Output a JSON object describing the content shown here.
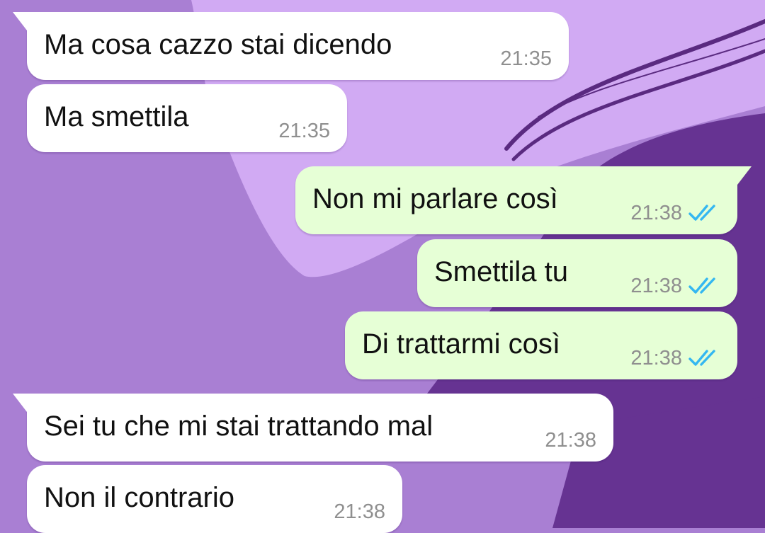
{
  "conversation": {
    "messages": [
      {
        "direction": "incoming",
        "text": "Ma cosa cazzo stai dicendo",
        "time": "21:35"
      },
      {
        "direction": "incoming",
        "text": "Ma smettila",
        "time": "21:35"
      },
      {
        "direction": "outgoing",
        "text": "Non mi parlare così",
        "time": "21:38",
        "status": "read"
      },
      {
        "direction": "outgoing",
        "text": "Smettila tu",
        "time": "21:38",
        "status": "read"
      },
      {
        "direction": "outgoing",
        "text": "Di trattarmi così",
        "time": "21:38",
        "status": "read"
      },
      {
        "direction": "incoming",
        "text": "Sei tu che mi stai trattando mal",
        "time": "21:38"
      },
      {
        "direction": "incoming",
        "text": "Non il contrario",
        "time": "21:38"
      }
    ]
  },
  "icons": {
    "read_receipt": "double-check-icon"
  },
  "colors": {
    "incoming_bubble": "#ffffff",
    "outgoing_bubble": "#e6ffd6",
    "read_ticks": "#34b7f1",
    "timestamp": "#8f8f8f",
    "wallpaper_mid": "#a97fd3",
    "wallpaper_light": "#d1aaf3",
    "wallpaper_dark": "#663392"
  }
}
